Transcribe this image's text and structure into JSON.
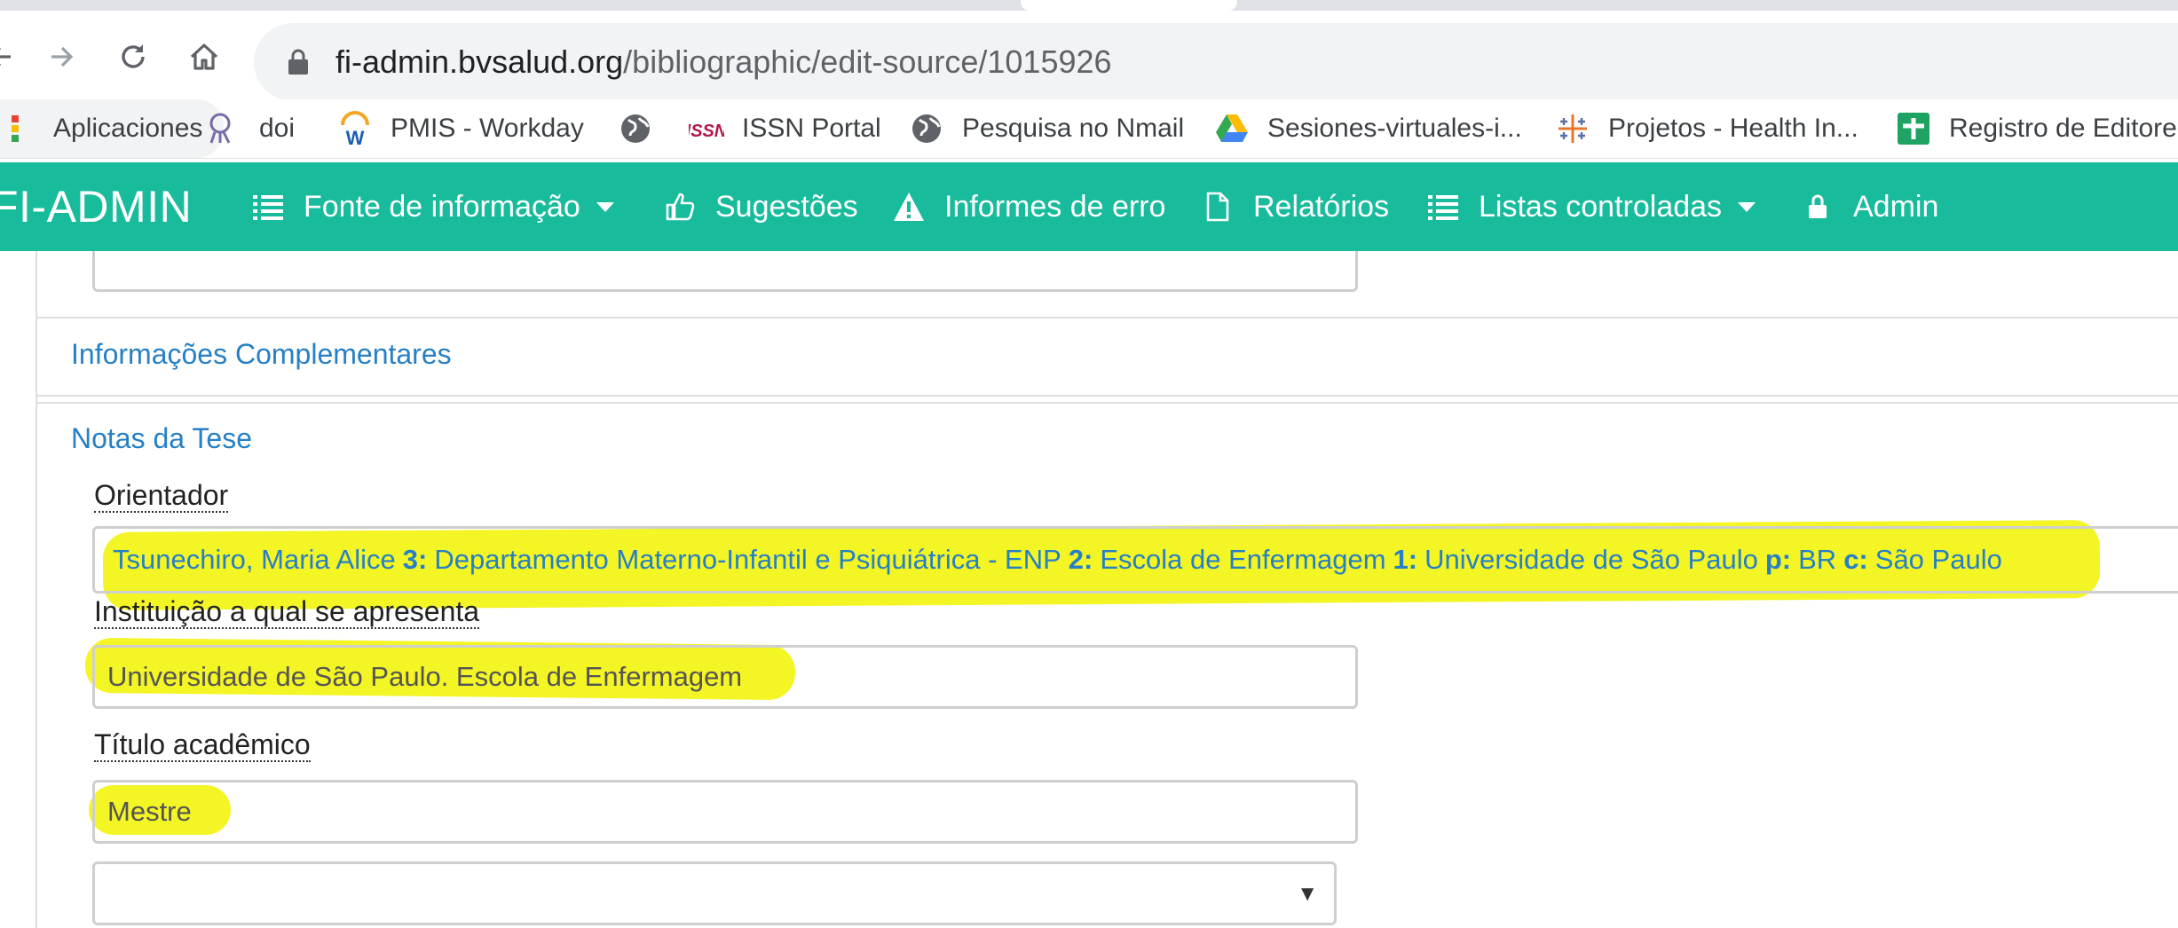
{
  "browser": {
    "url_host": "fi-admin.bvsalud.org",
    "url_path": "/bibliographic/edit-source/1015926",
    "bookmarks": [
      {
        "label": "Aplicaciones",
        "icon": "apps-icon"
      },
      {
        "label": "doi",
        "icon": "doi-icon"
      },
      {
        "label": "PMIS - Workday",
        "icon": "workday-icon"
      },
      {
        "label": "",
        "icon": "globe-icon"
      },
      {
        "label": "ISSN Portal",
        "icon": "issn-icon"
      },
      {
        "label": "Pesquisa no Nmail",
        "icon": "globe-icon"
      },
      {
        "label": "Sesiones-virtuales-i...",
        "icon": "google-drive-icon"
      },
      {
        "label": "Projetos - Health In...",
        "icon": "tableau-icon"
      },
      {
        "label": "Registro de Editore",
        "icon": "green-cross-icon"
      }
    ]
  },
  "appnav": {
    "brand": "FI-ADMIN",
    "items": [
      {
        "label": "Fonte de informação",
        "icon": "list-icon",
        "dropdown": true
      },
      {
        "label": "Sugestões",
        "icon": "thumbs-up-icon",
        "dropdown": false
      },
      {
        "label": "Informes de erro",
        "icon": "warning-icon",
        "dropdown": false
      },
      {
        "label": "Relatórios",
        "icon": "file-icon",
        "dropdown": false
      },
      {
        "label": "Listas controladas",
        "icon": "list-icon",
        "dropdown": true
      },
      {
        "label": "Admin",
        "icon": "lock-icon",
        "dropdown": false
      }
    ],
    "color": "#18bc9c"
  },
  "panels": {
    "complementary": {
      "title": "Informações Complementares"
    },
    "thesis": {
      "title": "Notas da Tese",
      "advisor": {
        "label": "Orientador",
        "name": "Tsunechiro, Maria Alice",
        "k3": "3:",
        "v3": "Departamento Materno-Infantil e Psiquiátrica - ENP",
        "k2": "2:",
        "v2": "Escola de Enfermagem",
        "k1": "1:",
        "v1": "Universidade de São Paulo",
        "kp": "p:",
        "vp": "BR",
        "kc": "c:",
        "vc": "São Paulo"
      },
      "institution": {
        "label": "Instituição a qual se apresenta",
        "value": "Universidade de São Paulo. Escola de Enfermagem"
      },
      "degree": {
        "label": "Título acadêmico",
        "value": "Mestre"
      },
      "select": {
        "value": ""
      }
    }
  },
  "colors": {
    "highlight": "#f4f40d",
    "link": "#2780c5"
  }
}
